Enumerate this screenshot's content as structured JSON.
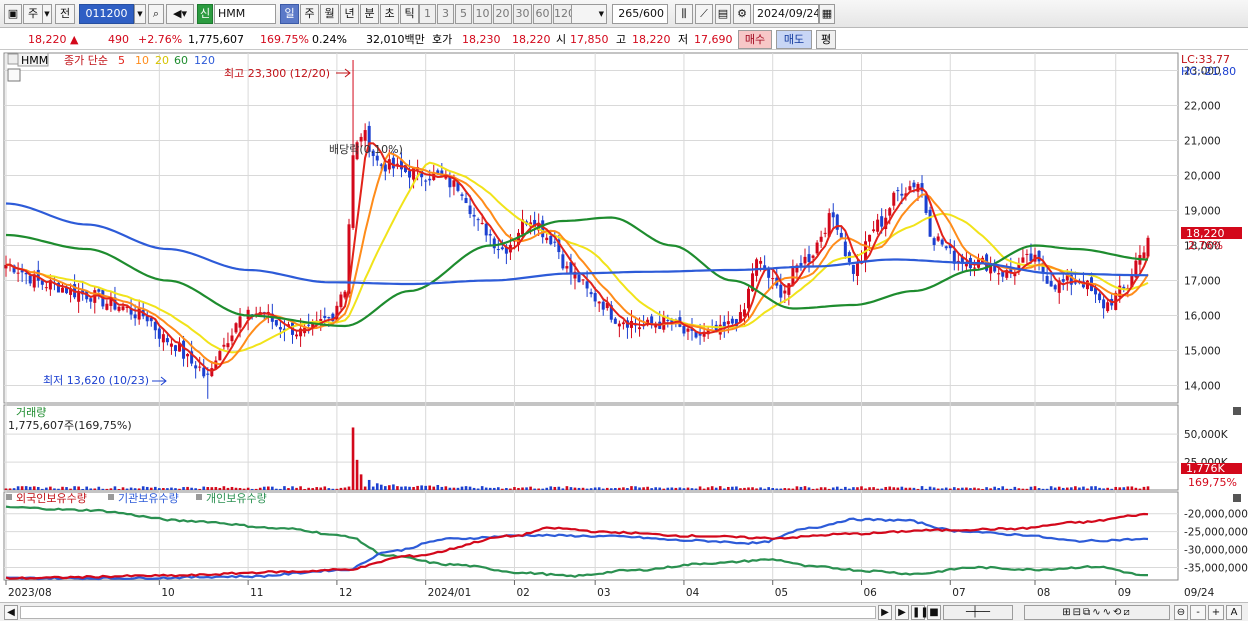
{
  "toolbar": {
    "mode": "주",
    "prev": "전",
    "code": "011200",
    "name_tag": "신",
    "name": "HMM",
    "periods": [
      "일",
      "주",
      "월",
      "년",
      "분",
      "초",
      "틱"
    ],
    "active_period": "일",
    "minutes": [
      "1",
      "3",
      "5",
      "10",
      "20",
      "30",
      "60",
      "120"
    ],
    "count": "265",
    "count_total": "/600",
    "date": "2024/09/24"
  },
  "price": {
    "current": "18,220",
    "change": "490",
    "change_pct": "+2.76%",
    "volume": "1,775,607",
    "volume_ratio": "169.75%",
    "turnover": "0.24%",
    "amount": "32,010백만",
    "quote_label": "호가",
    "ask": "18,230",
    "bid": "18,220",
    "open_label": "시",
    "open": "17,850",
    "high_label": "고",
    "high": "18,220",
    "low_label": "저",
    "low": "17,690",
    "buy": "매수",
    "sell": "매도",
    "avg": "평"
  },
  "colors": {
    "up": "#d3081b",
    "down": "#1c40d0",
    "ma5": "#e2231a",
    "ma10": "#ff8c1a",
    "ma20": "#f1e31a",
    "ma60": "#1e8c2e",
    "ma120": "#2d5bd8",
    "foreign": "#d3081b",
    "inst": "#2d5bd8",
    "indiv": "#2a9050"
  },
  "chart_data": [
    {
      "type": "candlestick",
      "title": "HMM",
      "legend": {
        "label": "종가 단순",
        "periods": [
          "5",
          "10",
          "20",
          "60",
          "120"
        ]
      },
      "ylim": [
        13500,
        23500
      ],
      "y_ticks": [
        "14,000",
        "15,000",
        "16,000",
        "17,000",
        "18,000",
        "19,000",
        "20,000",
        "21,000",
        "22,000",
        "23,000"
      ],
      "x_ticks": [
        "2023/08",
        "10",
        "11",
        "12",
        "2024/01",
        "02",
        "03",
        "04",
        "05",
        "06",
        "07",
        "08",
        "09",
        "09/24"
      ],
      "close_path": [
        [
          0,
          17450
        ],
        [
          10,
          16900
        ],
        [
          20,
          16600
        ],
        [
          27,
          16300
        ],
        [
          34,
          16000
        ],
        [
          40,
          15300
        ],
        [
          47,
          14600
        ],
        [
          50,
          14200
        ],
        [
          53,
          15100
        ],
        [
          58,
          15900
        ],
        [
          63,
          16100
        ],
        [
          68,
          15700
        ],
        [
          74,
          15500
        ],
        [
          80,
          15900
        ],
        [
          84,
          16800
        ],
        [
          86,
          20500
        ],
        [
          88,
          21200
        ],
        [
          93,
          20300
        ],
        [
          100,
          20100
        ],
        [
          106,
          20000
        ],
        [
          112,
          19700
        ],
        [
          118,
          18500
        ],
        [
          123,
          17900
        ],
        [
          130,
          18800
        ],
        [
          135,
          18200
        ],
        [
          140,
          17200
        ],
        [
          146,
          16500
        ],
        [
          152,
          15900
        ],
        [
          158,
          15700
        ],
        [
          164,
          15800
        ],
        [
          170,
          15400
        ],
        [
          176,
          15500
        ],
        [
          182,
          15900
        ],
        [
          186,
          17500
        ],
        [
          192,
          16700
        ],
        [
          198,
          17600
        ],
        [
          205,
          18800
        ],
        [
          210,
          17300
        ],
        [
          216,
          18600
        ],
        [
          222,
          19600
        ],
        [
          226,
          19800
        ],
        [
          230,
          18200
        ],
        [
          236,
          17600
        ],
        [
          242,
          17500
        ],
        [
          248,
          17200
        ],
        [
          254,
          17600
        ],
        [
          260,
          16900
        ],
        [
          266,
          17000
        ],
        [
          272,
          16300
        ],
        [
          277,
          16700
        ],
        [
          281,
          17700
        ],
        [
          283,
          18220
        ]
      ],
      "ma_levels": {
        "ma60": [
          [
            0,
            18300
          ],
          [
            20,
            17900
          ],
          [
            40,
            17000
          ],
          [
            60,
            16000
          ],
          [
            84,
            15700
          ],
          [
            100,
            16700
          ],
          [
            120,
            18000
          ],
          [
            138,
            18700
          ],
          [
            150,
            18800
          ],
          [
            165,
            18000
          ],
          [
            180,
            17000
          ],
          [
            195,
            16200
          ],
          [
            210,
            16300
          ],
          [
            225,
            16700
          ],
          [
            240,
            17300
          ],
          [
            255,
            18000
          ],
          [
            265,
            17900
          ],
          [
            283,
            17600
          ]
        ],
        "ma120": [
          [
            0,
            19200
          ],
          [
            20,
            18600
          ],
          [
            40,
            17900
          ],
          [
            60,
            17300
          ],
          [
            80,
            16950
          ],
          [
            100,
            16900
          ],
          [
            120,
            17000
          ],
          [
            140,
            17200
          ],
          [
            160,
            17250
          ],
          [
            180,
            17300
          ],
          [
            200,
            17400
          ],
          [
            220,
            17600
          ],
          [
            240,
            17500
          ],
          [
            260,
            17200
          ],
          [
            283,
            17150
          ]
        ]
      },
      "annotations": [
        {
          "text": "최고 23,300 (12/20)",
          "value": 23300
        },
        {
          "text": "최저 13,620 (10/23)",
          "value": 13620
        },
        {
          "text": "배당락(0.10%)"
        }
      ],
      "right_labels": {
        "lc": "LC:33,77",
        "hc": "HC:-21,80",
        "price": "18,220",
        "pct": "2.76%"
      }
    },
    {
      "type": "bar",
      "title": "거래량",
      "subtitle": "1,775,607주(169,75%)",
      "ylim": [
        0,
        60000
      ],
      "y_ticks": [
        "25,000K",
        "50,000K"
      ],
      "spikes": [
        [
          86,
          56000
        ],
        [
          87,
          27000
        ],
        [
          88,
          14000
        ],
        [
          90,
          9000
        ],
        [
          92,
          6000
        ],
        [
          96,
          5000
        ]
      ],
      "last_value_label": "1,776K",
      "last_pct_label": "169,75%"
    },
    {
      "type": "line",
      "series_labels": [
        "외국인보유수량",
        "기관보유수량",
        "개인보유수량"
      ],
      "ylim": [
        -38500000,
        -17000000
      ],
      "y_ticks": [
        "-20,000,000",
        "-25,000,000",
        "-30,000,000",
        "-35,000,000"
      ]
    }
  ],
  "status": {
    "zoom_plus": "+",
    "zoom_minus": "-",
    "font_a": "A"
  }
}
